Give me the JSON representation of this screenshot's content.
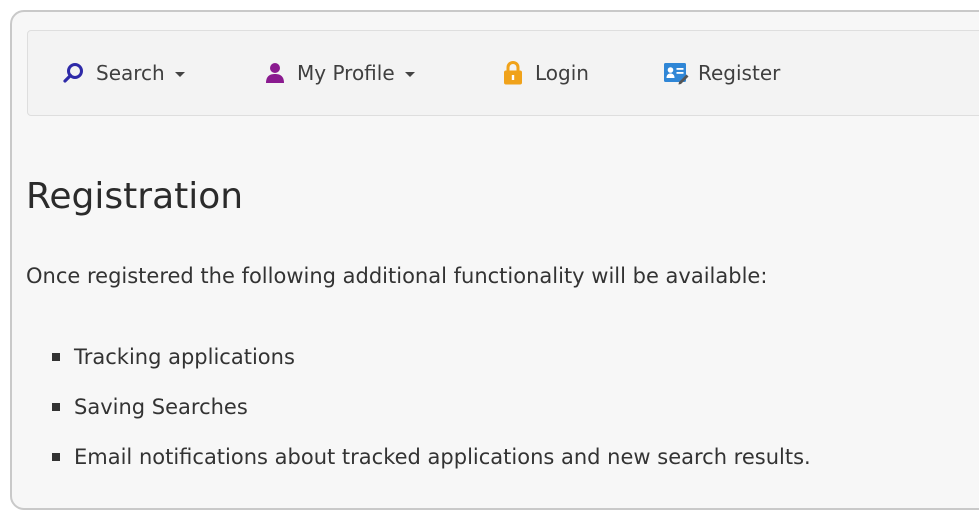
{
  "nav": {
    "search_label": "Search",
    "profile_label": "My Profile",
    "login_label": "Login",
    "register_label": "Register",
    "icons": {
      "search": "search-icon",
      "profile": "user-icon",
      "login": "lock-icon",
      "register": "register-card-icon"
    },
    "colors": {
      "search_icon": "#2e2aa8",
      "profile_icon": "#8a1a8f",
      "login_icon": "#f0a21a",
      "register_icon": "#2f86d6"
    }
  },
  "main": {
    "title": "Registration",
    "intro": "Once registered the following additional functionality will be available:",
    "features": [
      "Tracking applications",
      "Saving Searches",
      "Email notifications about tracked applications and new search results."
    ]
  }
}
